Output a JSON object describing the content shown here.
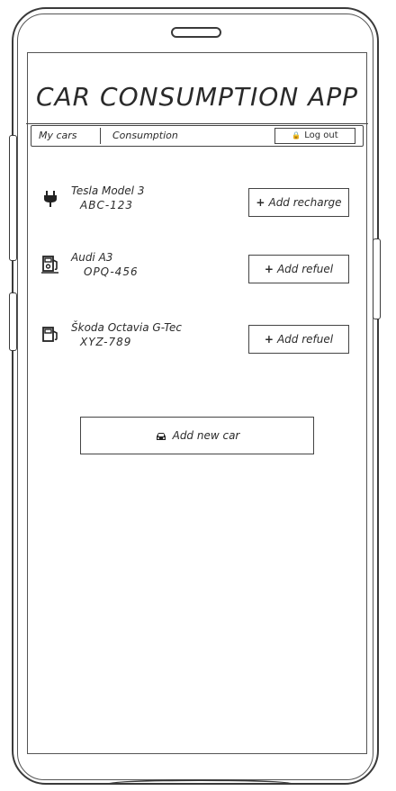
{
  "app": {
    "title": "CAR CONSUMPTION APP"
  },
  "nav": {
    "tabs": [
      {
        "label": "My cars"
      },
      {
        "label": "Consumption"
      }
    ],
    "logout_label": "Log out",
    "logout_icon": "lock-icon"
  },
  "cars": [
    {
      "name": "Tesla Model 3",
      "plate": "ABC-123",
      "icon": "ev-plug-icon",
      "action_label": "Add recharge"
    },
    {
      "name": "Audi A3",
      "plate": "OPQ-456",
      "icon": "fuel-pump-icon",
      "action_label": "Add refuel"
    },
    {
      "name": "Škoda Octavia G-Tec",
      "plate": "XYZ-789",
      "icon": "gas-pump-icon",
      "action_label": "Add refuel"
    }
  ],
  "add_car": {
    "label": "Add new car",
    "icon": "car-icon"
  }
}
